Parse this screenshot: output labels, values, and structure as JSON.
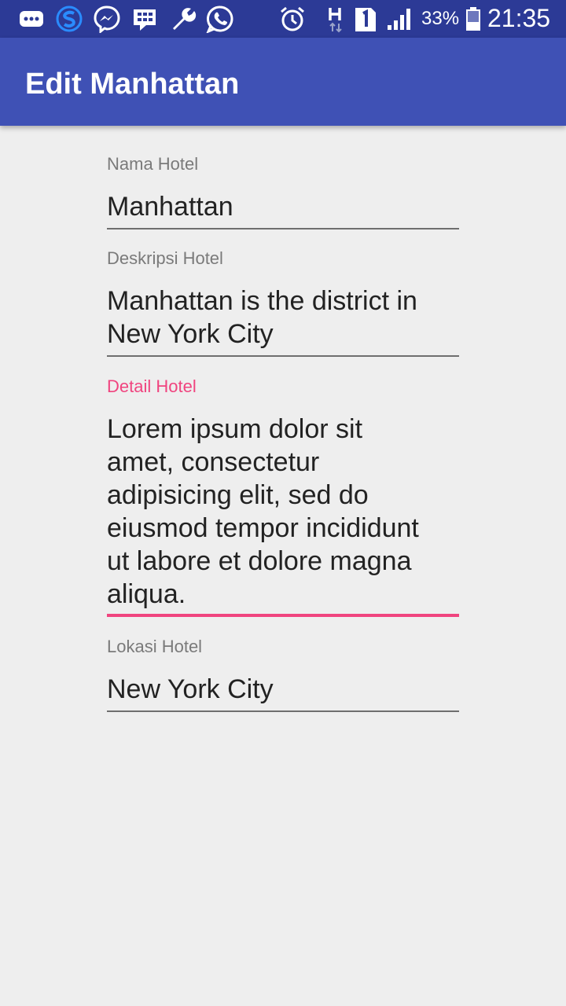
{
  "status_bar": {
    "battery_percent": "33%",
    "time": "21:35",
    "icons": [
      "chat-bubble-icon",
      "s-logo-icon",
      "messenger-icon",
      "bbm-icon",
      "wrench-icon",
      "whatsapp-icon",
      "alarm-icon",
      "h-signal-icon",
      "sim-1-icon",
      "signal-bars-icon",
      "battery-icon"
    ]
  },
  "app_bar": {
    "title": "Edit Manhattan"
  },
  "form": {
    "nama": {
      "label": "Nama Hotel",
      "value": "Manhattan"
    },
    "deskripsi": {
      "label": "Deskripsi Hotel",
      "value": "Manhattan is the district in\nNew York City"
    },
    "detail": {
      "label": "Detail Hotel",
      "value": "Lorem ipsum dolor sit\namet, consectetur\nadipisicing elit, sed do\neiusmod tempor incididunt\nut labore et dolore magna\naliqua."
    },
    "lokasi": {
      "label": "Lokasi Hotel",
      "value": "New York City"
    }
  },
  "colors": {
    "status_bar": "#2c3a96",
    "app_bar": "#3f51b5",
    "accent": "#f0447f",
    "background": "#eeeeee"
  }
}
